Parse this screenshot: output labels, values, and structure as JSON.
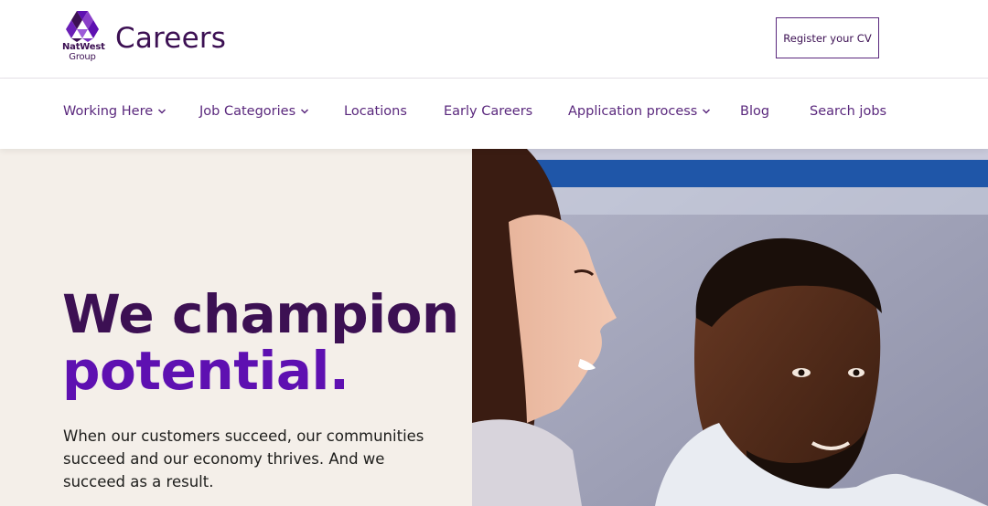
{
  "header": {
    "logo": {
      "line1": "NatWest",
      "line2": "Group"
    },
    "title": "Careers",
    "cta_label": "Register your CV"
  },
  "nav": {
    "items": [
      {
        "label": "Working Here",
        "has_dropdown": true
      },
      {
        "label": "Job Categories",
        "has_dropdown": true
      },
      {
        "label": "Locations",
        "has_dropdown": false
      },
      {
        "label": "Early Careers",
        "has_dropdown": false
      },
      {
        "label": "Application process",
        "has_dropdown": true
      },
      {
        "label": "Blog",
        "has_dropdown": false
      },
      {
        "label": "Search jobs",
        "has_dropdown": false
      }
    ]
  },
  "hero": {
    "headline_line1": "We champion",
    "headline_line2": "potential.",
    "body": "When our customers succeed, our communities succeed and our economy thrives. And we succeed as a result."
  },
  "colors": {
    "brand_dark_purple": "#3c1053",
    "brand_purple": "#5a287d",
    "accent_purple": "#5e10b1",
    "hero_bg": "#f4efe9"
  },
  "icons": [
    "natwest-logo-icon",
    "chevron-down-icon"
  ]
}
